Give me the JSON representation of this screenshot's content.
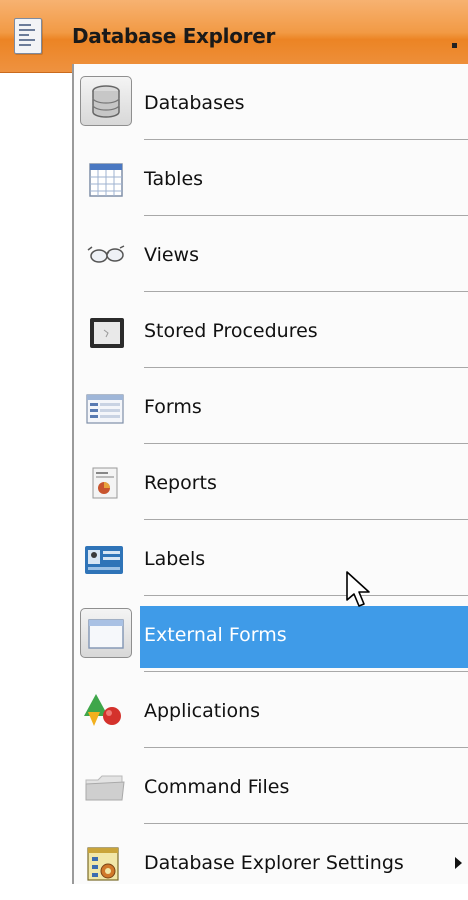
{
  "header": {
    "title": "Database Explorer",
    "icon": "app-document-icon",
    "colors": {
      "bar": "#ee8a2c"
    }
  },
  "menu": {
    "items": [
      {
        "label": "Databases",
        "icon": "database-icon"
      },
      {
        "label": "Tables",
        "icon": "table-icon"
      },
      {
        "label": "Views",
        "icon": "glasses-icon"
      },
      {
        "label": "Stored Procedures",
        "icon": "procedure-icon"
      },
      {
        "label": "Forms",
        "icon": "form-icon"
      },
      {
        "label": "Reports",
        "icon": "report-icon"
      },
      {
        "label": "Labels",
        "icon": "label-icon"
      },
      {
        "label": "External Forms",
        "icon": "window-icon",
        "state": "hovered"
      },
      {
        "label": "Applications",
        "icon": "applications-icon"
      },
      {
        "label": "Command Files",
        "icon": "folder-icon"
      },
      {
        "label": "Database Explorer Settings",
        "icon": "settings-icon",
        "has_submenu": true
      }
    ],
    "colors": {
      "highlight": "#3f9be8",
      "separator": "#a8a8a8"
    }
  }
}
